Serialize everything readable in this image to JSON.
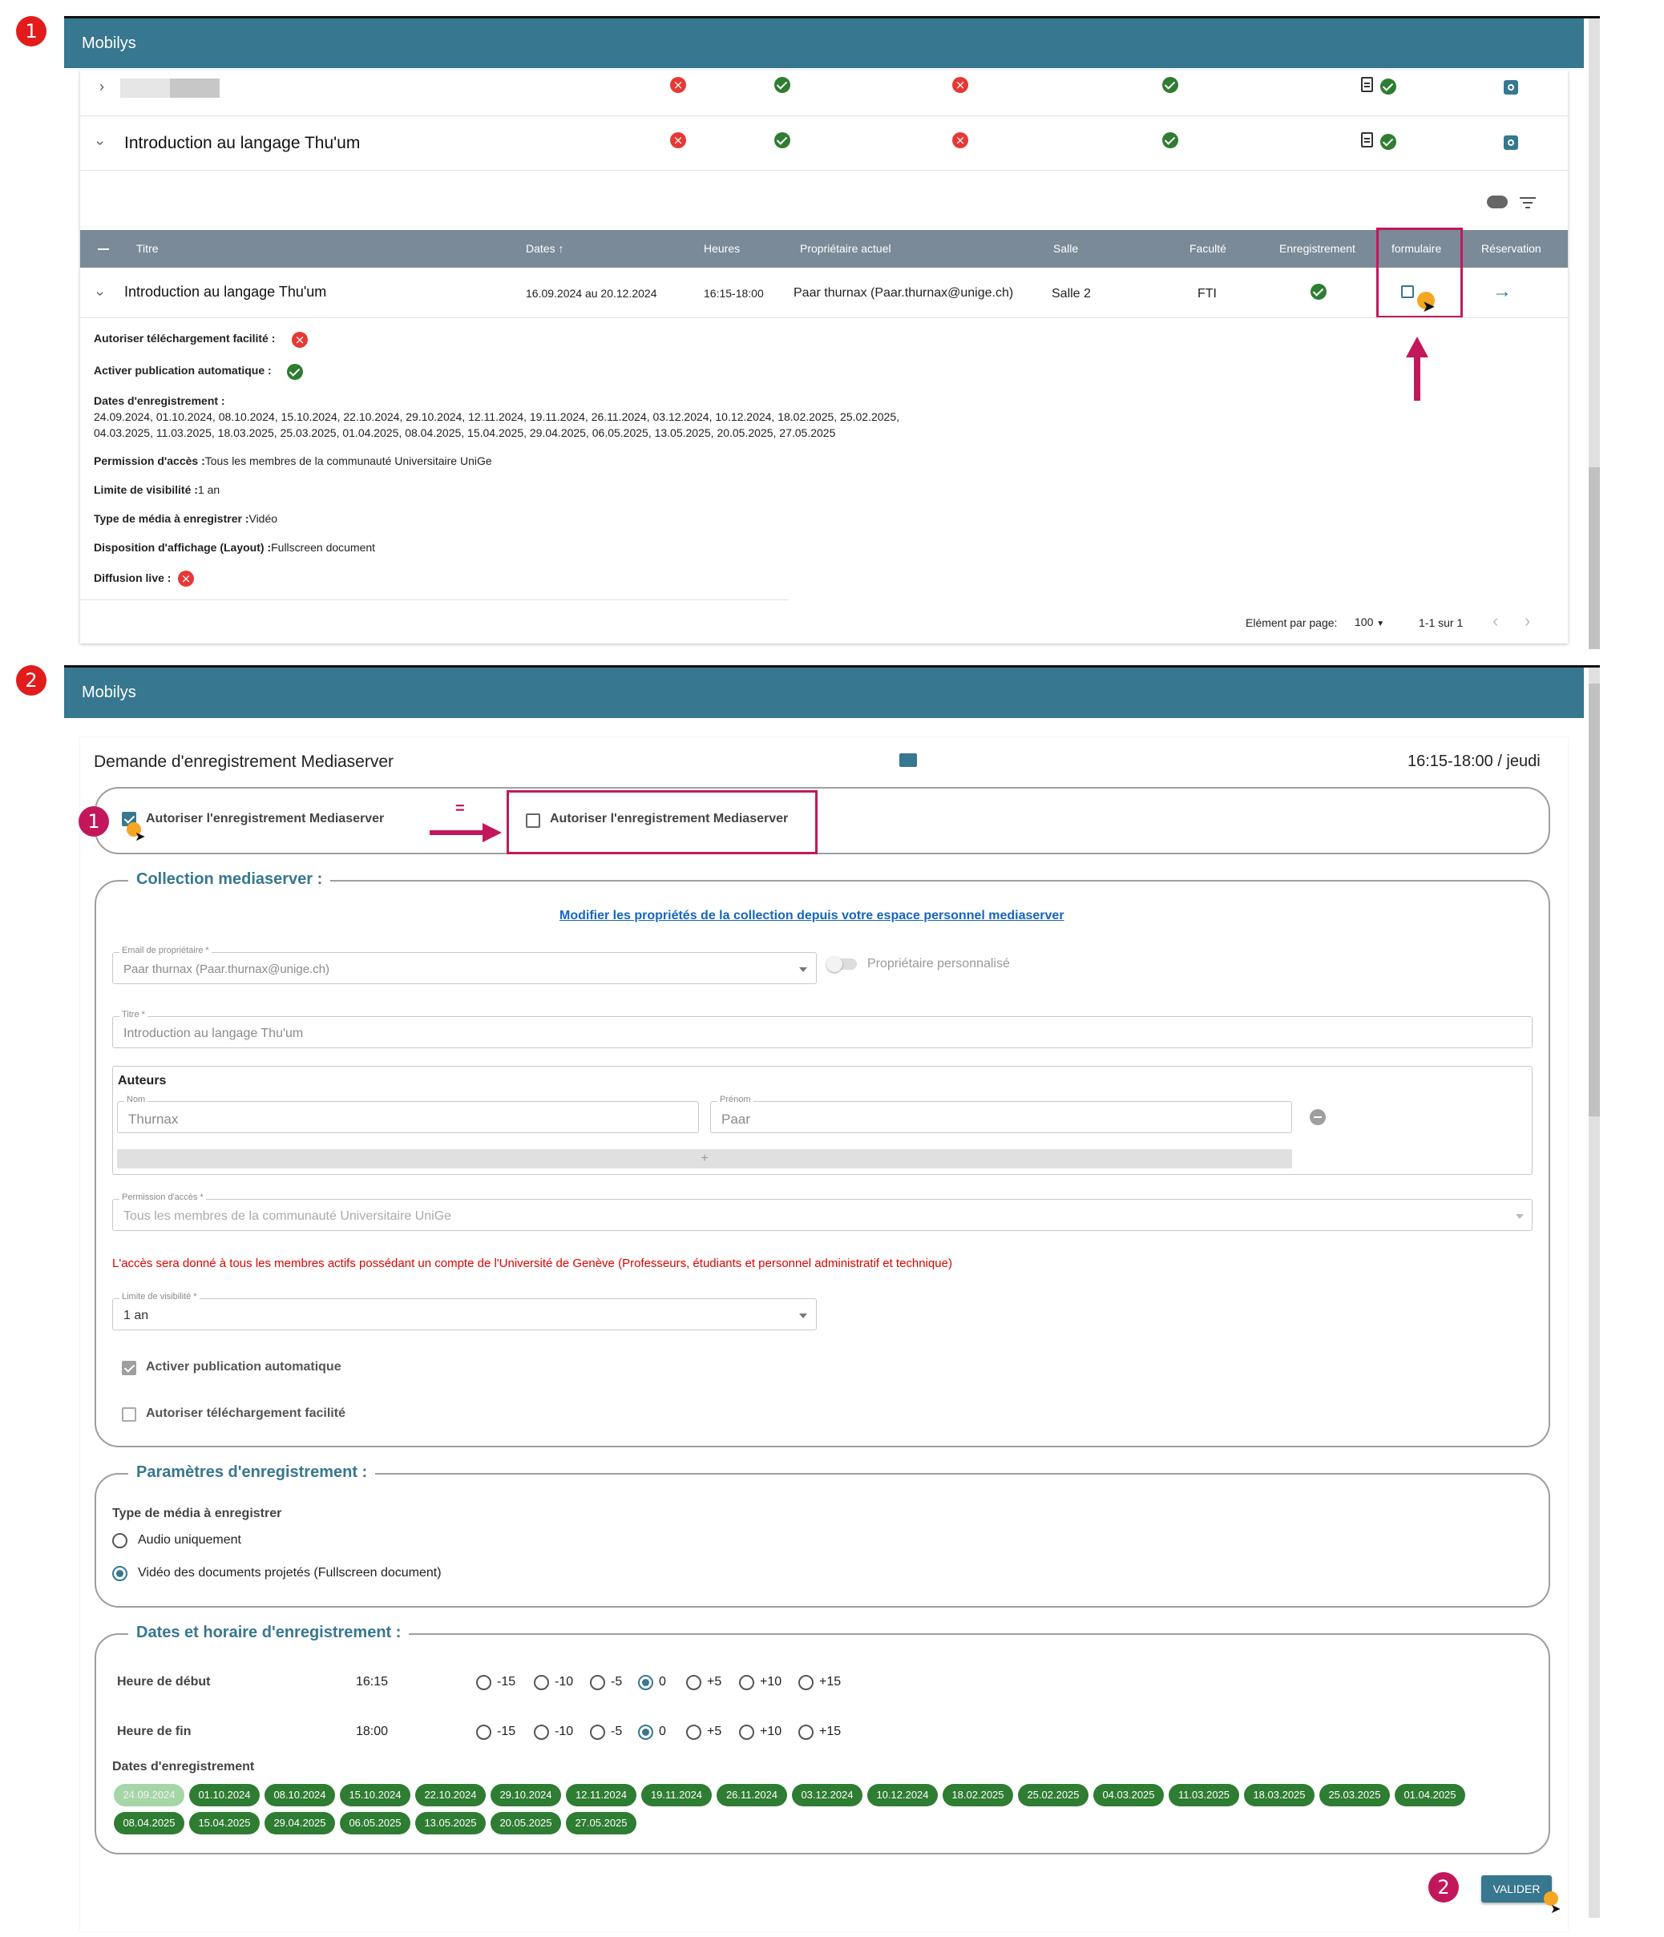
{
  "step_markers": {
    "one": "1",
    "two": "2",
    "inner_one": "1",
    "inner_two": "2"
  },
  "app_title": "Mobilys",
  "section1": {
    "rows": [
      {
        "title": "",
        "status": [
          "ko",
          "ok",
          "ko",
          "ok",
          "doc-ok",
          "gear"
        ]
      },
      {
        "title": "Introduction au langage Thu'um",
        "status": [
          "ko",
          "ok",
          "ko",
          "ok",
          "doc-ok",
          "gear"
        ]
      }
    ],
    "toolbar_icons": [
      "cloud-download-icon",
      "filter-icon"
    ],
    "table_headers": {
      "titre": "Titre",
      "dates": "Dates",
      "heures": "Heures",
      "proprietaire": "Propriétaire actuel",
      "salle": "Salle",
      "faculte": "Faculté",
      "enregistrement": "Enregistrement",
      "formulaire": "formulaire",
      "reservation": "Réservation"
    },
    "course_row": {
      "titre": "Introduction au langage Thu'um",
      "dates": "16.09.2024 au 20.12.2024",
      "heures": "16:15-18:00",
      "proprietaire": "Paar thurnax (Paar.thurnax@unige.ch)",
      "salle": "Salle 2",
      "faculte": "FTI"
    },
    "details": {
      "telechargement_label": "Autoriser téléchargement facilité :",
      "publication_label": "Activer publication automatique :",
      "dates_label": "Dates d'enregistrement :",
      "dates_line1": "24.09.2024, 01.10.2024, 08.10.2024, 15.10.2024, 22.10.2024, 29.10.2024, 12.11.2024, 19.11.2024, 26.11.2024, 03.12.2024, 10.12.2024, 18.02.2025, 25.02.2025,",
      "dates_line2": "04.03.2025, 11.03.2025, 18.03.2025, 25.03.2025, 01.04.2025, 08.04.2025, 15.04.2025, 29.04.2025, 06.05.2025, 13.05.2025, 20.05.2025, 27.05.2025",
      "permission_label": "Permission d'accès :",
      "permission_value": "Tous les membres de la communauté Universitaire UniGe",
      "limite_label": "Limite de visibilité :",
      "limite_value": "1 an",
      "media_label": "Type de média à enregistrer :",
      "media_value": "Vidéo",
      "layout_label": "Disposition d'affichage (Layout) :",
      "layout_value": "Fullscreen document",
      "live_label": "Diffusion live :"
    },
    "pagination": {
      "label": "Elément par page:",
      "per_page": "100",
      "range": "1-1 sur 1"
    }
  },
  "section2": {
    "form_title": "Demande d'enregistrement Mediaserver",
    "schedule": "16:15-18:00 / jeudi",
    "autoriser_label": "Autoriser l'enregistrement Mediaserver",
    "autoriser_label_zoom": "Autoriser l'enregistrement Mediaserver",
    "equals": "=",
    "collection": {
      "legend": "Collection mediaserver :",
      "link": "Modifier les propriétés de la collection depuis votre espace personnel mediaserver",
      "email_label": "Email de propriétaire *",
      "email_value": "Paar thurnax (Paar.thurnax@unige.ch)",
      "toggle_label": "Propriétaire personnalisé",
      "titre_label": "Titre *",
      "titre_value": "Introduction au langage Thu'um",
      "auteurs_label": "Auteurs",
      "nom_label": "Nom",
      "nom_value": "Thurnax",
      "prenom_label": "Prénom",
      "prenom_value": "Paar",
      "add_label": "+",
      "permission_label": "Permission d'accès *",
      "permission_value": "Tous les membres de la communauté Universitaire UniGe",
      "warning": "L'accès sera donné à tous les membres actifs possédant un compte de l'Université de Genève (Professeurs, étudiants et personnel administratif et technique)",
      "limite_label": "Limite de visibilité *",
      "limite_value": "1 an",
      "publication_label": "Activer publication automatique",
      "telechargement_label": "Autoriser téléchargement facilité"
    },
    "parametres": {
      "legend": "Paramètres d'enregistrement :",
      "media_label": "Type de média à enregistrer",
      "option_audio": "Audio uniquement",
      "option_video": "Vidéo des documents projetés (Fullscreen document)"
    },
    "horaire": {
      "legend": "Dates et horaire d'enregistrement :",
      "debut_label": "Heure de début",
      "debut_value": "16:15",
      "fin_label": "Heure de fin",
      "fin_value": "18:00",
      "offsets": [
        "-15",
        "-10",
        "-5",
        "0",
        "+5",
        "+10",
        "+15"
      ],
      "selected_offset": "0",
      "dates_label": "Dates d'enregistrement",
      "dates": [
        "24.09.2024",
        "01.10.2024",
        "08.10.2024",
        "15.10.2024",
        "22.10.2024",
        "29.10.2024",
        "12.11.2024",
        "19.11.2024",
        "26.11.2024",
        "03.12.2024",
        "10.12.2024",
        "18.02.2025",
        "25.02.2025",
        "04.03.2025",
        "11.03.2025",
        "18.03.2025",
        "25.03.2025",
        "01.04.2025",
        "08.04.2025",
        "15.04.2025",
        "29.04.2025",
        "06.05.2025",
        "13.05.2025",
        "20.05.2025",
        "27.05.2025"
      ]
    },
    "valider": "VALIDER"
  },
  "colors": {
    "header": "#37778f",
    "highlight": "#c2185b",
    "chip": "#2e7d32",
    "warning": "#e00000"
  }
}
